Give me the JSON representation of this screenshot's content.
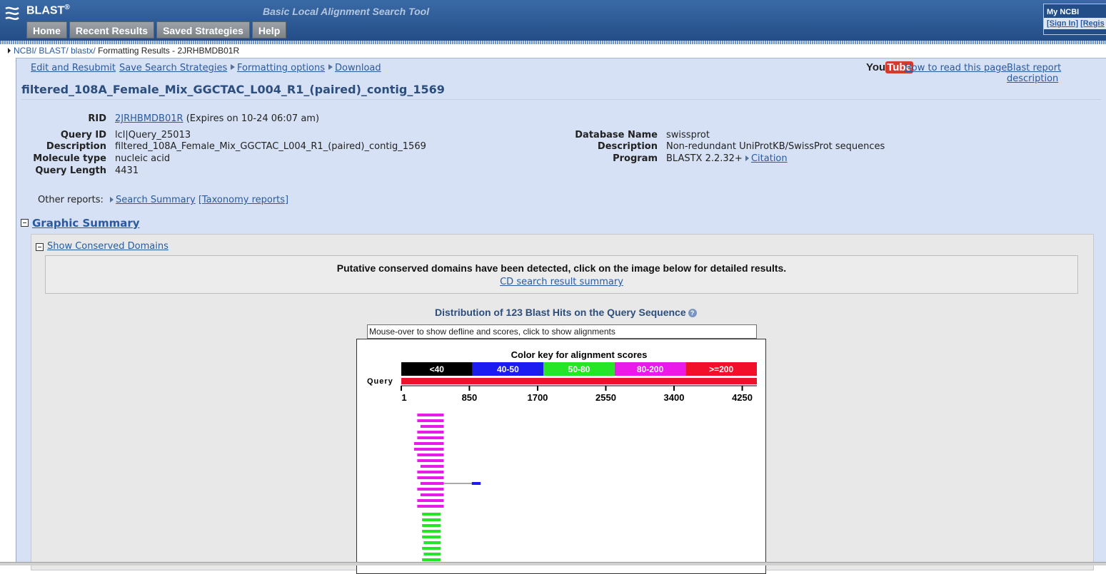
{
  "header": {
    "app_name": "BLAST",
    "app_mark": "®",
    "tagline": "Basic Local Alignment Search Tool",
    "nav": [
      "Home",
      "Recent Results",
      "Saved Strategies",
      "Help"
    ],
    "my_ncbi": {
      "title": "My NCBI",
      "sign_in": "[Sign In]",
      "register": "[Regis"
    }
  },
  "breadcrumb": {
    "ncbi": "NCBI/",
    "blast": "BLAST/",
    "blastx": "blastx/",
    "current": "Formatting Results - 2JRHBMDB01R"
  },
  "toplinks": {
    "edit_resubmit": "Edit and Resubmit",
    "save_strategies": "Save Search Strategies",
    "formatting_options": "Formatting options",
    "download": "Download",
    "youtube_you": "You",
    "youtube_tube": "Tube",
    "how_to_read": "How to read this page",
    "report_description": "Blast report description"
  },
  "query": {
    "title": "filtered_108A_Female_Mix_GGCTAC_L004_R1_(paired)_contig_1569",
    "rid_label": "RID",
    "rid_value": "2JRHBMDB01R",
    "rid_expires": "(Expires on 10-24 06:07 am)",
    "query_id_label": "Query ID",
    "query_id_value": "lcl|Query_25013",
    "description_label": "Description",
    "description_value": "filtered_108A_Female_Mix_GGCTAC_L004_R1_(paired)_contig_1569",
    "molecule_label": "Molecule type",
    "molecule_value": "nucleic acid",
    "length_label": "Query Length",
    "length_value": "4431"
  },
  "database": {
    "name_label": "Database Name",
    "name_value": "swissprot",
    "description_label": "Description",
    "description_value": "Non-redundant UniProtKB/SwissProt sequences",
    "program_label": "Program",
    "program_value": "BLASTX 2.2.32+",
    "citation": "Citation"
  },
  "other_reports": {
    "label": "Other reports:",
    "search_summary": "Search Summary",
    "taxonomy": "[Taxonomy reports]"
  },
  "graphic_summary": {
    "title": "Graphic Summary",
    "show_cd": "Show Conserved Domains",
    "cd_message": "Putative conserved domains have been detected, click on the image below for detailed results.",
    "cd_link": "CD search result summary",
    "distribution_title": "Distribution of 123 Blast Hits on the Query Sequence",
    "hit_input_value": "Mouse-over to show defline and scores, click to show alignments"
  },
  "chart_data": {
    "type": "bar",
    "title": "Color key for alignment scores",
    "query_label": "Query",
    "color_key": [
      {
        "label": "<40",
        "color": "#000000"
      },
      {
        "label": "40-50",
        "color": "#1c1cf0"
      },
      {
        "label": "50-80",
        "color": "#25e626"
      },
      {
        "label": "80-200",
        "color": "#ea1aea"
      },
      {
        "label": ">=200",
        "color": "#f0102a"
      }
    ],
    "query_bar_color": "#f0102a",
    "query_length": 4431,
    "ticks": [
      "1",
      "850",
      "1700",
      "2550",
      "3400",
      "4250"
    ],
    "tick_values": [
      1,
      850,
      1700,
      2550,
      3400,
      4250
    ],
    "hits": [
      {
        "start": 200,
        "end": 530,
        "score_bin": "80-200"
      },
      {
        "start": 200,
        "end": 530,
        "score_bin": "80-200"
      },
      {
        "start": 240,
        "end": 530,
        "score_bin": "80-200"
      },
      {
        "start": 200,
        "end": 530,
        "score_bin": "80-200"
      },
      {
        "start": 200,
        "end": 530,
        "score_bin": "80-200"
      },
      {
        "start": 160,
        "end": 530,
        "score_bin": "80-200"
      },
      {
        "start": 160,
        "end": 530,
        "score_bin": "80-200"
      },
      {
        "start": 200,
        "end": 530,
        "score_bin": "80-200"
      },
      {
        "start": 200,
        "end": 530,
        "score_bin": "80-200"
      },
      {
        "start": 240,
        "end": 530,
        "score_bin": "80-200"
      },
      {
        "start": 200,
        "end": 530,
        "score_bin": "80-200"
      },
      {
        "start": 200,
        "end": 530,
        "score_bin": "80-200"
      },
      {
        "start": 240,
        "end": 530,
        "score_bin": "80-200",
        "linked": {
          "start": 880,
          "end": 990,
          "score_bin": "40-50"
        }
      },
      {
        "start": 200,
        "end": 530,
        "score_bin": "80-200"
      },
      {
        "start": 240,
        "end": 530,
        "score_bin": "80-200"
      },
      {
        "start": 200,
        "end": 530,
        "score_bin": "80-200"
      },
      {
        "start": 200,
        "end": 530,
        "score_bin": "80-200"
      },
      {
        "start": 260,
        "end": 490,
        "score_bin": "50-80"
      },
      {
        "start": 260,
        "end": 490,
        "score_bin": "50-80"
      },
      {
        "start": 260,
        "end": 490,
        "score_bin": "50-80"
      },
      {
        "start": 260,
        "end": 490,
        "score_bin": "50-80"
      },
      {
        "start": 260,
        "end": 490,
        "score_bin": "50-80"
      },
      {
        "start": 280,
        "end": 490,
        "score_bin": "50-80"
      },
      {
        "start": 260,
        "end": 490,
        "score_bin": "50-80"
      },
      {
        "start": 280,
        "end": 490,
        "score_bin": "50-80"
      },
      {
        "start": 260,
        "end": 490,
        "score_bin": "50-80"
      }
    ]
  }
}
